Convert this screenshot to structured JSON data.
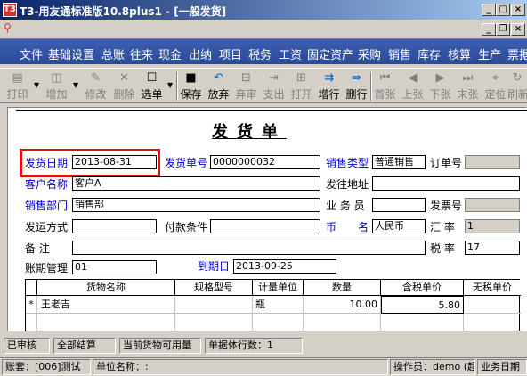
{
  "window": {
    "title": "T3-用友通标准版10.8plus1 - [一般发货]"
  },
  "menu": [
    "文件",
    "基础设置",
    "总账",
    "往来",
    "现金",
    "出纳",
    "项目",
    "税务",
    "工资",
    "固定资产",
    "采购",
    "销售",
    "库存",
    "核算",
    "生产",
    "票据"
  ],
  "toolbar": [
    {
      "label": "打印",
      "icon": "▤",
      "enabled": false
    },
    {
      "label": "增加",
      "icon": "◫",
      "enabled": false
    },
    {
      "label": "修改",
      "icon": "✎",
      "enabled": false
    },
    {
      "label": "删除",
      "icon": "✕",
      "enabled": false
    },
    {
      "label": "选单",
      "icon": "☐",
      "enabled": true
    },
    {
      "label": "保存",
      "icon": "■",
      "enabled": true
    },
    {
      "label": "放弃",
      "icon": "↶",
      "enabled": true
    },
    {
      "label": "弃审",
      "icon": "⊟",
      "enabled": false
    },
    {
      "label": "支出",
      "icon": "⇥",
      "enabled": false
    },
    {
      "label": "打开",
      "icon": "⊞",
      "enabled": false
    },
    {
      "label": "增行",
      "icon": "⇉",
      "enabled": true
    },
    {
      "label": "删行",
      "icon": "⇛",
      "enabled": true
    },
    {
      "label": "首张",
      "icon": "⏮",
      "enabled": false
    },
    {
      "label": "上张",
      "icon": "◀",
      "enabled": false
    },
    {
      "label": "下张",
      "icon": "▶",
      "enabled": false
    },
    {
      "label": "末张",
      "icon": "⏭",
      "enabled": false
    },
    {
      "label": "定位",
      "icon": "⌖",
      "enabled": false
    },
    {
      "label": "刷新",
      "icon": "↻",
      "enabled": false
    }
  ],
  "form": {
    "title": "发货单",
    "ship_date_label": "发货日期",
    "ship_date": "2013-08-31",
    "ship_no_label": "发货单号",
    "ship_no": "0000000032",
    "sales_type_label": "销售类型",
    "sales_type": "普通销售",
    "order_no_label": "订单号",
    "order_no": "",
    "customer_label": "客户名称",
    "customer": "客户A",
    "ship_addr_label": "发往地址",
    "ship_addr": "",
    "dept_label": "销售部门",
    "dept": "销售部",
    "salesman_label": "业 务 员",
    "salesman": "",
    "invoice_no_label": "发票号",
    "invoice_no": "",
    "ship_method_label": "发运方式",
    "ship_method": "",
    "pay_terms_label": "付款条件",
    "pay_terms": "",
    "currency_label1": "币",
    "currency_label2": "名",
    "currency": "人民币",
    "rate_label": "汇  率",
    "rate": "1",
    "note_label": "备    注",
    "note": "",
    "tax_label": "税  率",
    "tax": "17",
    "period_label": "账期管理",
    "period": "01",
    "due_label": "到期日",
    "due": "2013-09-25"
  },
  "grid": {
    "columns": [
      "货物名称",
      "规格型号",
      "计量单位",
      "数量",
      "含税单价",
      "无税单价"
    ],
    "rows": [
      {
        "marker": "*",
        "name": "王老吉",
        "spec": "",
        "unit": "瓶",
        "qty": "10.00",
        "price": "5.80",
        "notax": ""
      }
    ]
  },
  "status1": [
    "已审核",
    "全部结算",
    "当前货物可用量",
    "单据体行数：1"
  ],
  "status2": [
    "账套：[006]测试",
    "单位名称：:",
    "操作员：demo (超",
    "业务日期"
  ]
}
